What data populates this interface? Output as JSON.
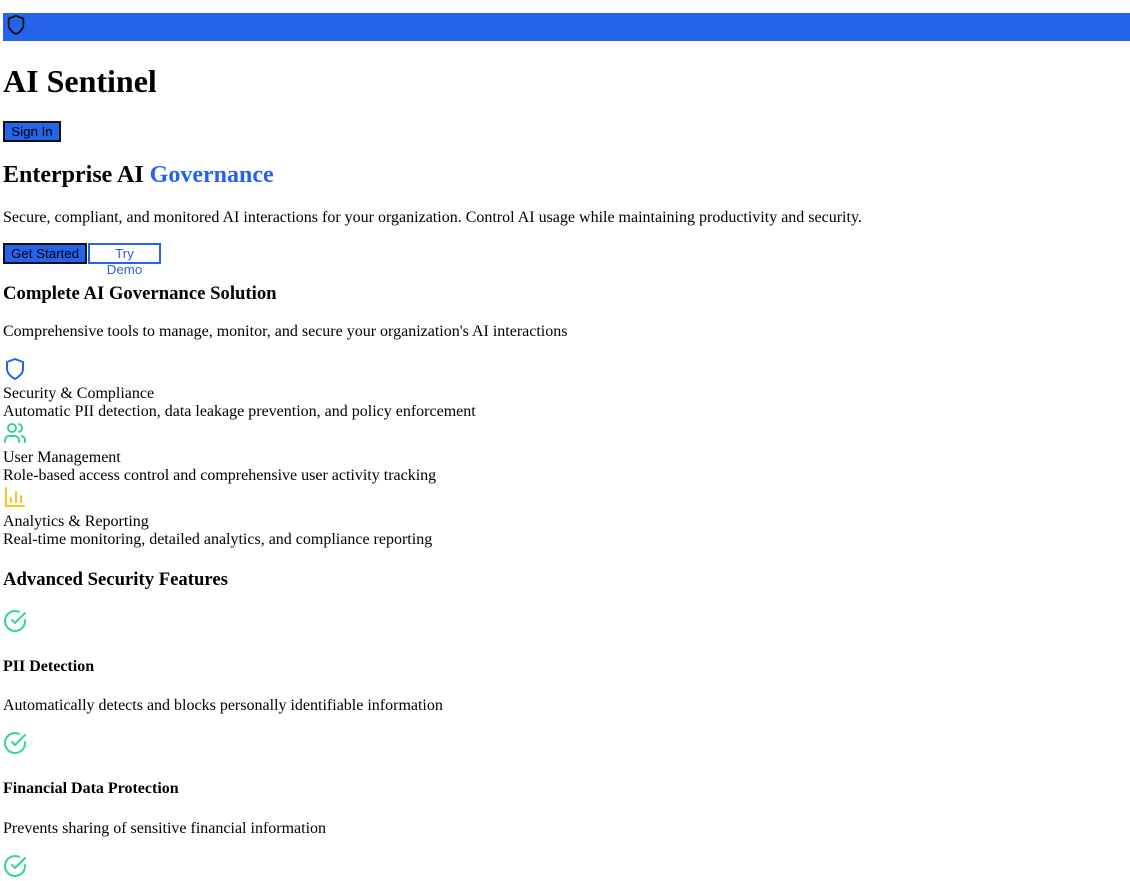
{
  "header": {
    "logo_icon": "shield-icon",
    "bar_color": "#2563eb",
    "app_title": "AI Sentinel",
    "sign_in_label": "Sign In"
  },
  "hero": {
    "title_prefix": "Enterprise AI ",
    "title_accent": "Governance",
    "accent_color": "#2563eb",
    "description": "Secure, compliant, and monitored AI interactions for your organization. Control AI usage while maintaining productivity and security.",
    "get_started_label": "Get Started",
    "try_demo_label": "Try Demo"
  },
  "solution": {
    "title": "Complete AI Governance Solution",
    "description": "Comprehensive tools to manage, monitor, and secure your organization's AI interactions",
    "features": [
      {
        "icon": "shield-icon",
        "color": "#2563eb",
        "title": "Security & Compliance",
        "description": "Automatic PII detection, data leakage prevention, and policy enforcement"
      },
      {
        "icon": "users-icon",
        "color": "#34d399",
        "title": "User Management",
        "description": "Role-based access control and comprehensive user activity tracking"
      },
      {
        "icon": "bar-chart-icon",
        "color": "#fbbf24",
        "title": "Analytics & Reporting",
        "description": "Real-time monitoring, detailed analytics, and compliance reporting"
      }
    ]
  },
  "advanced": {
    "title": "Advanced Security Features",
    "check_color": "#34d399",
    "items": [
      {
        "icon": "check-circle-icon",
        "title": "PII Detection",
        "description": "Automatically detects and blocks personally identifiable information"
      },
      {
        "icon": "check-circle-icon",
        "title": "Financial Data Protection",
        "description": "Prevents sharing of sensitive financial information"
      },
      {
        "icon": "check-circle-icon"
      }
    ]
  }
}
